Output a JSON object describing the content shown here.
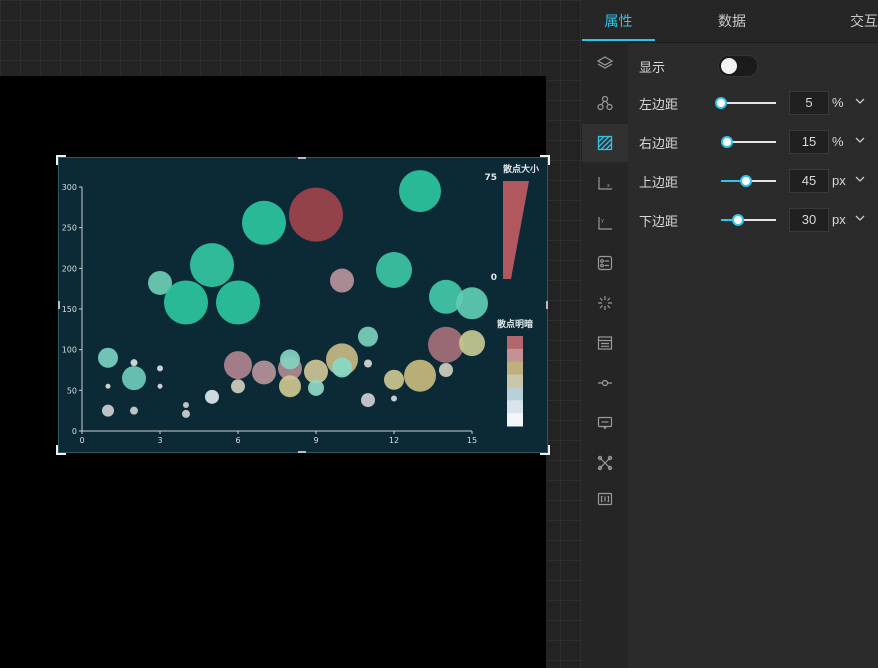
{
  "tabs": [
    {
      "label": "属性",
      "active": true
    },
    {
      "label": "数据",
      "active": false
    },
    {
      "label": "交互",
      "active": false
    }
  ],
  "sidebar_icons": [
    "layers-icon",
    "nodes-icon",
    "hatch-pattern-icon",
    "x-axis-icon",
    "y-axis-icon",
    "legend-settings-icon",
    "sparkle-effect-icon",
    "data-table-icon",
    "slider-line-icon",
    "tooltip-icon",
    "tools-icon",
    "bracket-code-icon"
  ],
  "properties": {
    "show": {
      "label": "显示",
      "on": false
    },
    "left_margin": {
      "label": "左边距",
      "value": "5",
      "unit": "%",
      "fraction": 0.0
    },
    "right_margin": {
      "label": "右边距",
      "value": "15",
      "unit": "%",
      "fraction": 0.1
    },
    "top_margin": {
      "label": "上边距",
      "value": "45",
      "unit": "px",
      "fraction": 0.45
    },
    "bottom_margin": {
      "label": "下边距",
      "value": "30",
      "unit": "px",
      "fraction": 0.3
    }
  },
  "colors": {
    "accent": "#2fc4e8",
    "chart_bg": "#0b2a36"
  },
  "chart_data": {
    "type": "scatter",
    "xlim": [
      0,
      15
    ],
    "ylim": [
      0,
      300
    ],
    "xticks": [
      "0",
      "3",
      "6",
      "9",
      "12",
      "15"
    ],
    "yticks": [
      "0",
      "50",
      "100",
      "150",
      "200",
      "250",
      "300"
    ],
    "grid": false,
    "size_legend": {
      "title": "散点大小",
      "max_label": "75",
      "min_label": "0"
    },
    "color_legend": {
      "title": "散点明暗",
      "colors": [
        "#b4666e",
        "#c49296",
        "#bfae7e",
        "#c8c8a8",
        "#b8d0d8",
        "#dae4ea",
        "#f2f6f8"
      ]
    },
    "points": [
      {
        "x": 13,
        "y": 295,
        "r": 21,
        "color": "#2ec5a0"
      },
      {
        "x": 9,
        "y": 266,
        "r": 27,
        "color": "#a0434c"
      },
      {
        "x": 7,
        "y": 256,
        "r": 22,
        "color": "#2ec5a0"
      },
      {
        "x": 5,
        "y": 204,
        "r": 22,
        "color": "#34c5a2"
      },
      {
        "x": 12,
        "y": 198,
        "r": 18,
        "color": "#3ec5a4"
      },
      {
        "x": 3,
        "y": 182,
        "r": 12,
        "color": "#6ecdb6"
      },
      {
        "x": 10,
        "y": 185,
        "r": 12,
        "color": "#b8949c"
      },
      {
        "x": 4,
        "y": 158,
        "r": 22,
        "color": "#2ec5a0"
      },
      {
        "x": 6,
        "y": 158,
        "r": 22,
        "color": "#2ec5a0"
      },
      {
        "x": 14,
        "y": 165,
        "r": 17,
        "color": "#44c8a8"
      },
      {
        "x": 15,
        "y": 157,
        "r": 16,
        "color": "#60ccb2"
      },
      {
        "x": 11,
        "y": 116,
        "r": 10,
        "color": "#7ad0ba"
      },
      {
        "x": 14,
        "y": 106,
        "r": 18,
        "color": "#a6707a"
      },
      {
        "x": 15,
        "y": 108,
        "r": 13,
        "color": "#c6c890"
      },
      {
        "x": 1,
        "y": 90,
        "r": 10,
        "color": "#7ad0c0"
      },
      {
        "x": 2,
        "y": 65,
        "r": 12,
        "color": "#6ecbba"
      },
      {
        "x": 6,
        "y": 81,
        "r": 14,
        "color": "#b0848e"
      },
      {
        "x": 7,
        "y": 72,
        "r": 12,
        "color": "#b6949a"
      },
      {
        "x": 8,
        "y": 77,
        "r": 12,
        "color": "#b08a92"
      },
      {
        "x": 8,
        "y": 88,
        "r": 10,
        "color": "#84d2be"
      },
      {
        "x": 9,
        "y": 73,
        "r": 12,
        "color": "#cfc496"
      },
      {
        "x": 10,
        "y": 88,
        "r": 16,
        "color": "#c8b882"
      },
      {
        "x": 10,
        "y": 78,
        "r": 10,
        "color": "#88d8c4"
      },
      {
        "x": 12,
        "y": 63,
        "r": 10,
        "color": "#cec690"
      },
      {
        "x": 13,
        "y": 68,
        "r": 16,
        "color": "#c8ba7e"
      },
      {
        "x": 8,
        "y": 55,
        "r": 11,
        "color": "#cec690"
      },
      {
        "x": 9,
        "y": 53,
        "r": 8,
        "color": "#90d8c6"
      },
      {
        "x": 14,
        "y": 75,
        "r": 7,
        "color": "#cfcfbe"
      },
      {
        "x": 6,
        "y": 55,
        "r": 7,
        "color": "#cfcfbe"
      },
      {
        "x": 5,
        "y": 42,
        "r": 7,
        "color": "#dde8ee"
      },
      {
        "x": 11,
        "y": 38,
        "r": 7,
        "color": "#cfcfd0"
      },
      {
        "x": 1,
        "y": 25,
        "r": 6,
        "color": "#cfcfd0"
      },
      {
        "x": 2,
        "y": 25,
        "r": 4,
        "color": "#cfcfd0"
      },
      {
        "x": 4,
        "y": 21,
        "r": 4,
        "color": "#cfcfd0"
      },
      {
        "x": 4,
        "y": 32,
        "r": 3,
        "color": "#cfcfd0"
      },
      {
        "x": 1,
        "y": 55,
        "r": 2.5,
        "color": "#e0e0e0"
      },
      {
        "x": 3,
        "y": 55,
        "r": 2.5,
        "color": "#e0e0e0"
      },
      {
        "x": 3,
        "y": 77,
        "r": 3,
        "color": "#e0e0e0"
      },
      {
        "x": 2,
        "y": 84,
        "r": 3.5,
        "color": "#e0e0e0"
      },
      {
        "x": 11,
        "y": 83,
        "r": 4,
        "color": "#d8d8d8"
      },
      {
        "x": 12,
        "y": 40,
        "r": 3,
        "color": "#d8d8d8"
      }
    ]
  }
}
